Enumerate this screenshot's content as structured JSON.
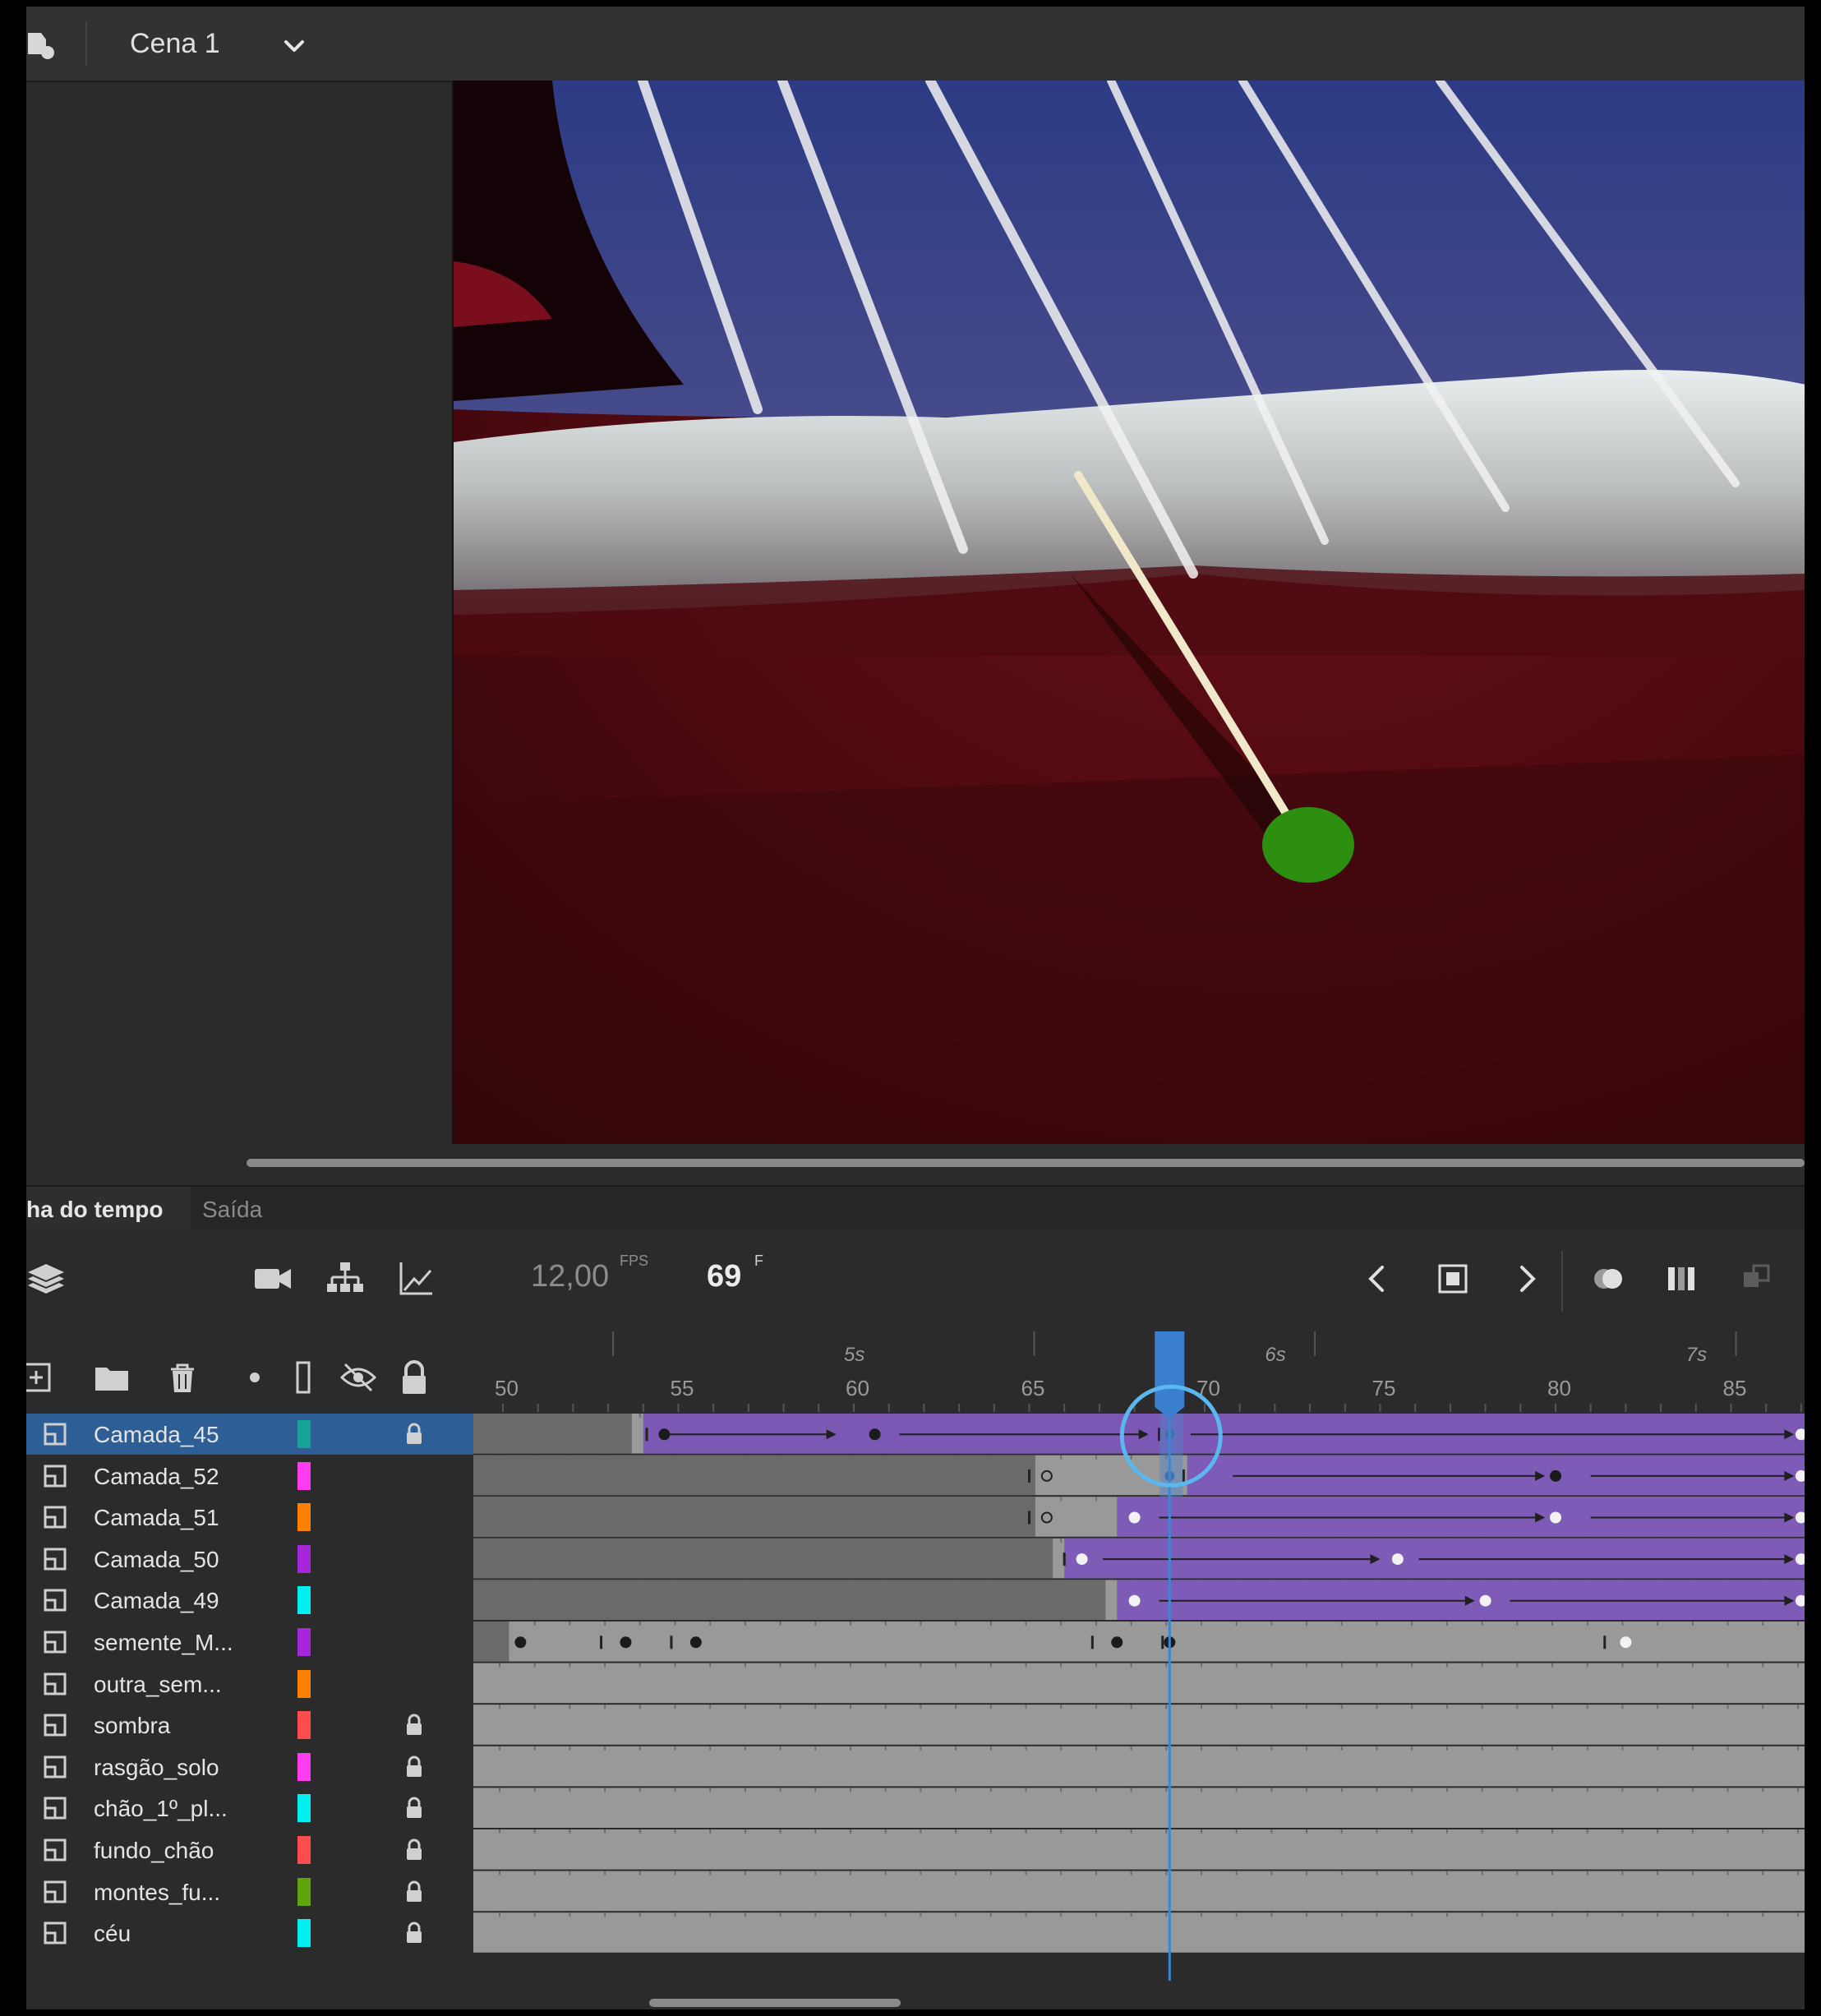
{
  "scene": {
    "name": "Cena 1"
  },
  "tabs": {
    "timeline": "ha do tempo",
    "output": "Saída"
  },
  "toolbar": {
    "fps": "12,00",
    "fps_unit": "FPS",
    "frame": "69",
    "frame_unit": "F"
  },
  "ruler": {
    "numbers": [
      "50",
      "55",
      "60",
      "65",
      "70",
      "75",
      "80",
      "85"
    ],
    "seconds": [
      "5s",
      "6s",
      "7s"
    ]
  },
  "playhead_frame": 69,
  "layers": [
    {
      "name": "Camada_45",
      "color": "#14a394",
      "locked": true,
      "selected": true
    },
    {
      "name": "Camada_52",
      "color": "#ff3cf0",
      "locked": false
    },
    {
      "name": "Camada_51",
      "color": "#ff7f00",
      "locked": false
    },
    {
      "name": "Camada_50",
      "color": "#a626d9",
      "locked": false
    },
    {
      "name": "Camada_49",
      "color": "#00f0f0",
      "locked": false
    },
    {
      "name": "semente_M...",
      "color": "#a626d9",
      "locked": false
    },
    {
      "name": "outra_sem...",
      "color": "#ff7f00",
      "locked": false
    },
    {
      "name": "sombra",
      "color": "#ff4c4c",
      "locked": true
    },
    {
      "name": "rasgão_solo",
      "color": "#ff3cf0",
      "locked": true
    },
    {
      "name": "chão_1º_pl...",
      "color": "#00f0f0",
      "locked": true
    },
    {
      "name": "fundo_chão",
      "color": "#ff4c4c",
      "locked": true
    },
    {
      "name": "montes_fu...",
      "color": "#5fa30d",
      "locked": true
    },
    {
      "name": "céu",
      "color": "#00f0f0",
      "locked": true
    }
  ],
  "tracks": [
    {
      "tween": [
        [
          54,
          87
        ]
      ],
      "keys": [
        [
          54.6,
          "b"
        ],
        [
          60.6,
          "b"
        ],
        [
          69,
          "bs"
        ],
        [
          87,
          "w"
        ]
      ],
      "arrows": [
        [
          54.6,
          59.5
        ],
        [
          61.3,
          68.4
        ],
        [
          69.6,
          86.8
        ]
      ],
      "ticks": [
        54.1,
        68.7
      ]
    },
    {
      "tween": [
        [
          69.5,
          87
        ]
      ],
      "keys": [
        [
          65.5,
          "o"
        ],
        [
          69,
          "bs"
        ],
        [
          80,
          "b"
        ],
        [
          87,
          "w"
        ]
      ],
      "arrows": [
        [
          70.8,
          79.7
        ],
        [
          81,
          86.8
        ]
      ],
      "ticks": [
        65,
        69.4
      ]
    },
    {
      "tween": [
        [
          67.5,
          87
        ]
      ],
      "keys": [
        [
          65.5,
          "o"
        ],
        [
          68,
          "w"
        ],
        [
          80,
          "w"
        ],
        [
          87,
          "w"
        ]
      ],
      "arrows": [
        [
          68.7,
          79.7
        ],
        [
          81,
          86.8
        ]
      ],
      "ticks": [
        65
      ]
    },
    {
      "tween": [
        [
          66,
          87
        ]
      ],
      "keys": [
        [
          66.5,
          "w"
        ],
        [
          75.5,
          "w"
        ],
        [
          87,
          "w"
        ]
      ],
      "arrows": [
        [
          67.1,
          75
        ],
        [
          76.1,
          86.8
        ]
      ],
      "ticks": [
        66
      ]
    },
    {
      "tween": [
        [
          67.5,
          87
        ]
      ],
      "keys": [
        [
          68,
          "w"
        ],
        [
          78,
          "w"
        ],
        [
          87,
          "w"
        ]
      ],
      "arrows": [
        [
          68.7,
          77.7
        ],
        [
          78.7,
          86.8
        ]
      ],
      "ticks": []
    },
    {
      "tween": [],
      "keys": [
        [
          50.5,
          "b"
        ],
        [
          53.5,
          "b"
        ],
        [
          55.5,
          "b"
        ],
        [
          67.5,
          "b"
        ],
        [
          69,
          "b"
        ],
        [
          82,
          "w"
        ]
      ],
      "arrows": [],
      "ticks": [
        52.8,
        54.8,
        66.8,
        68.8,
        81.4
      ]
    },
    {
      "tween": [],
      "keys": [],
      "arrows": [],
      "ticks": []
    },
    {
      "tween": [],
      "keys": [],
      "arrows": [],
      "ticks": []
    },
    {
      "tween": [],
      "keys": [],
      "arrows": [],
      "ticks": []
    },
    {
      "tween": [],
      "keys": [],
      "arrows": [],
      "ticks": []
    },
    {
      "tween": [],
      "keys": [],
      "arrows": [],
      "ticks": []
    },
    {
      "tween": [],
      "keys": [],
      "arrows": [],
      "ticks": []
    },
    {
      "tween": [],
      "keys": [],
      "arrows": [],
      "ticks": []
    }
  ],
  "icons": [
    "scene-icon",
    "chevron-down-icon",
    "layers-icon",
    "camera-icon",
    "hierarchy-icon",
    "graph-icon",
    "prev-keyframe-icon",
    "add-keyframe-icon",
    "next-keyframe-icon",
    "onion-skin-icon",
    "edit-multiple-frames-icon",
    "loop-icon",
    "new-layer-icon",
    "new-folder-icon",
    "delete-icon",
    "dot-icon",
    "outline-icon",
    "visibility-icon",
    "lock-icon"
  ]
}
